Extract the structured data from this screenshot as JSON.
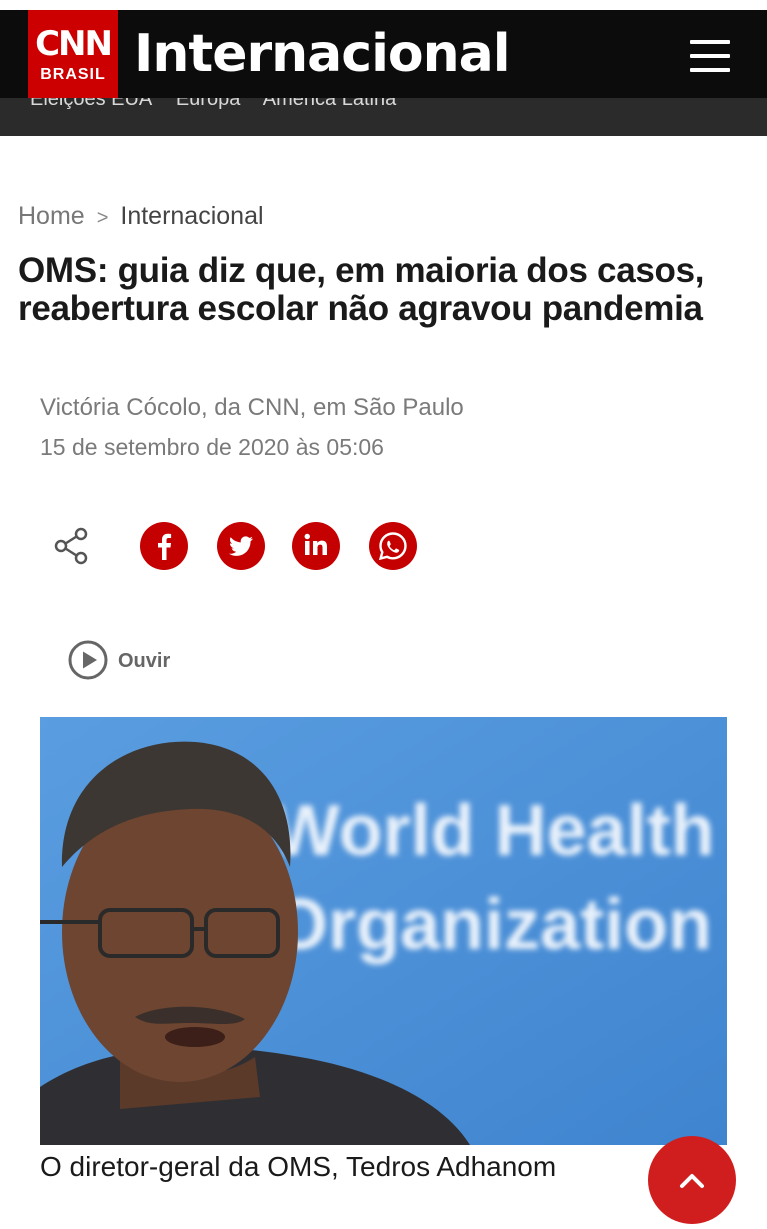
{
  "header": {
    "logo_text": "CNN",
    "logo_sub": "BRASIL",
    "section_title": "Internacional",
    "menu_icon": "hamburger-menu-icon"
  },
  "subnav": {
    "items": [
      "Eleições EUA",
      "Europa",
      "América Latina"
    ]
  },
  "breadcrumb": {
    "home": "Home",
    "separator": ">",
    "current": "Internacional"
  },
  "article": {
    "headline": "OMS: guia diz que, em maioria dos casos, reabertura escolar não agravou pandemia",
    "author": "Victória Cócolo, da CNN, em São Paulo",
    "date": "15 de setembro de 2020 às 05:06"
  },
  "share": {
    "icons": [
      "share-icon",
      "facebook-icon",
      "twitter-icon",
      "linkedin-icon",
      "whatsapp-icon"
    ],
    "accent_color": "#c40000"
  },
  "listen": {
    "label": "Ouvir"
  },
  "photo": {
    "backdrop_text_line1": "World Health",
    "backdrop_text_line2": "Organization"
  },
  "caption": "O diretor-geral da OMS, Tedros Adhanom",
  "colors": {
    "brand_red": "#cc0000",
    "header_bg": "#0c0c0c",
    "subnav_bg": "#2b2b2b"
  }
}
